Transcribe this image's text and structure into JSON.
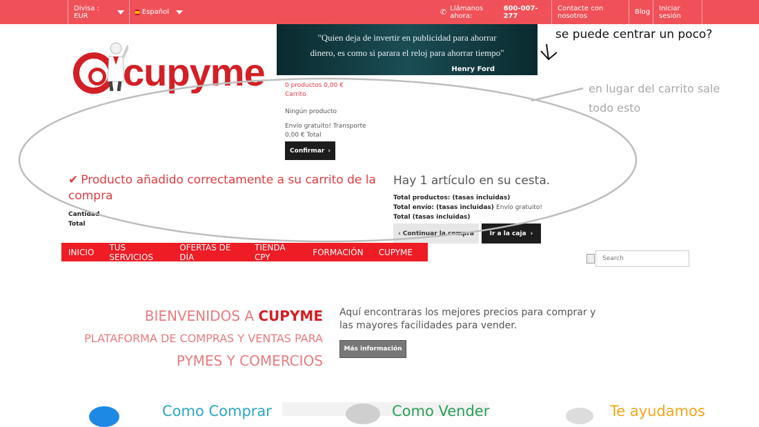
{
  "topbar": {
    "currency_label": "Divisa : EUR",
    "language_label": "Español",
    "phone_prefix": "Llámanos ahora:",
    "phone_number": "600-007-277",
    "contact_link": "Contacte con nosotros",
    "blog_link": "Blog",
    "login_link": "Iniciar sesión"
  },
  "logo": {
    "text": "cupyme"
  },
  "banner": {
    "quote_line1": "\"Quien deja de invertir en publicidad para ahorrar",
    "quote_line2": "dinero, es como si parara el reloj para ahorrar tiempo\"",
    "author": "Henry Ford"
  },
  "notes": {
    "note1": "se puede centrar un poco?",
    "note2": "en lugar del carrito sale todo esto"
  },
  "cart": {
    "summary_line1": "0 productos 0,00 €",
    "summary_line2": "Carrito",
    "no_product": "Ningún producto",
    "shipping_line": "Envío gratuito! Transporte",
    "total_line": "0,00 € Total",
    "confirm_button": "Confirmar"
  },
  "layer_cart": {
    "added_message": "Producto añadido correctamente a su carrito de la compra",
    "quantity_label": "Cantidad",
    "total_label": "Total",
    "items_title": "Hay 1 artículo en su cesta.",
    "total_products": "Total productos: (tasas incluidas)",
    "total_shipping": "Total envío: (tasas incluidas)",
    "shipping_value": "Envío gratuito!",
    "total_taxes": "Total (tasas incluidas)",
    "continue_button": "Continuar la compra",
    "checkout_button": "Ir a la caja"
  },
  "menu": {
    "items": [
      "INICIO",
      "TUS SERVICIOS",
      "OFERTAS DE DÍA",
      "TIENDA CPY",
      "FORMACIÓN",
      "CUPYME"
    ]
  },
  "search": {
    "placeholder": "Search"
  },
  "welcome": {
    "line1_prefix": "BIENVENIDOS A",
    "line1_brand": "CUPYME",
    "line2": "PLATAFORMA DE COMPRAS Y VENTAS PARA",
    "line3": "PYMES Y COMERCIOS",
    "description": "Aquí encontraras los mejores precios para comprar y las mayores facilidades para vender.",
    "more_button": "Más información"
  },
  "teasers": [
    {
      "label": "Como Comprar"
    },
    {
      "label": "Como Vender"
    },
    {
      "label": "Te ayudamos"
    }
  ],
  "colors": {
    "brand_red": "#ee1c24",
    "topbar": "#f05158",
    "dark_button": "#1d1d1d"
  }
}
